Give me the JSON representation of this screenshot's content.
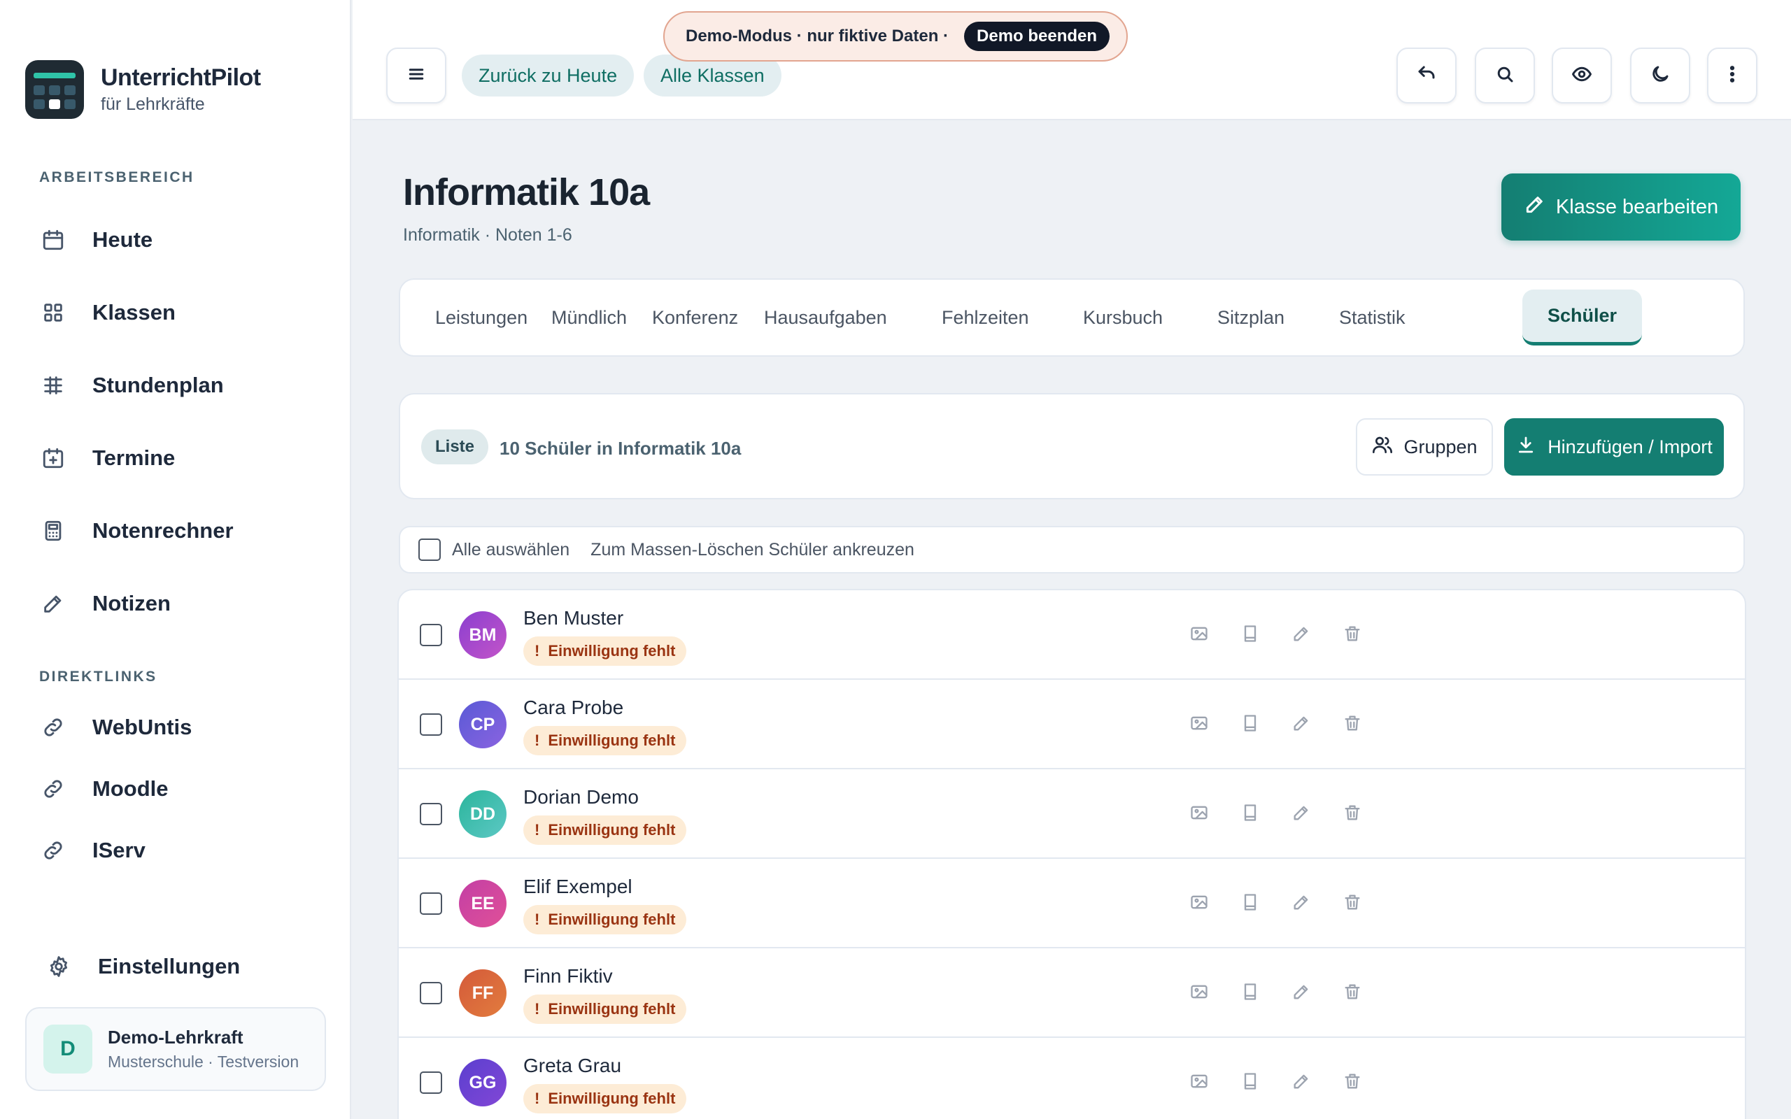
{
  "brand": {
    "name": "UnterrichtPilot",
    "subtitle": "für Lehrkräfte"
  },
  "sidebar": {
    "workspace_label": "ARBEITSBEREICH",
    "items": [
      {
        "label": "Heute",
        "icon": "calendar-icon"
      },
      {
        "label": "Klassen",
        "icon": "grid-icon"
      },
      {
        "label": "Stundenplan",
        "icon": "timetable-icon"
      },
      {
        "label": "Termine",
        "icon": "calendar-plus-icon"
      },
      {
        "label": "Notenrechner",
        "icon": "calculator-icon"
      },
      {
        "label": "Notizen",
        "icon": "pencil-icon"
      }
    ],
    "links_label": "DIREKTLINKS",
    "links": [
      {
        "label": "WebUntis",
        "icon": "link-icon"
      },
      {
        "label": "Moodle",
        "icon": "link-icon"
      },
      {
        "label": "IServ",
        "icon": "link-icon"
      }
    ],
    "settings_label": "Einstellungen",
    "user": {
      "initial": "D",
      "name": "Demo-Lehrkraft",
      "subtitle": "Musterschule · Testversion"
    }
  },
  "topbar": {
    "back_label": "Zurück zu Heute",
    "all_classes_label": "Alle Klassen",
    "demo_text": "Demo-Modus · nur fiktive Daten ·",
    "demo_end_label": "Demo beenden",
    "icons": [
      "menu-icon",
      "undo-icon",
      "search-icon",
      "eye-icon",
      "moon-icon",
      "more-vertical-icon"
    ]
  },
  "page": {
    "title": "Informatik 10a",
    "subject": "Informatik",
    "separator": "·",
    "grading": "Noten 1-6",
    "edit_label": "Klasse bearbeiten"
  },
  "tabs": [
    {
      "label": "Leistungen",
      "active": false
    },
    {
      "label": "Mündlich",
      "active": false
    },
    {
      "label": "Konferenz",
      "active": false
    },
    {
      "label": "Hausaufgaben",
      "active": false
    },
    {
      "label": "Fehlzeiten",
      "active": false
    },
    {
      "label": "Kursbuch",
      "active": false
    },
    {
      "label": "Sitzplan",
      "active": false
    },
    {
      "label": "Statistik",
      "active": false
    },
    {
      "label": "Schüler",
      "active": true
    }
  ],
  "list_header": {
    "view_badge": "Liste",
    "count_text": "10 Schüler in Informatik 10a",
    "groups_label": "Gruppen",
    "import_label": "Hinzufügen / Import"
  },
  "selection": {
    "select_all_label": "Alle auswählen",
    "hint": "Zum Massen-Löschen Schüler ankreuzen"
  },
  "students": [
    {
      "initials": "BM",
      "name": "Ben Muster",
      "warning": "Einwilligung fehlt",
      "color_from": "#8b3fd0",
      "color_to": "#c354c8"
    },
    {
      "initials": "CP",
      "name": "Cara Probe",
      "warning": "Einwilligung fehlt",
      "color_from": "#5a5ad6",
      "color_to": "#8a63e0"
    },
    {
      "initials": "DD",
      "name": "Dorian Demo",
      "warning": "Einwilligung fehlt",
      "color_from": "#2bb59c",
      "color_to": "#5cc8c4"
    },
    {
      "initials": "EE",
      "name": "Elif Exempel",
      "warning": "Einwilligung fehlt",
      "color_from": "#c33fa5",
      "color_to": "#e05098"
    },
    {
      "initials": "FF",
      "name": "Finn Fiktiv",
      "warning": "Einwilligung fehlt",
      "color_from": "#d45a3a",
      "color_to": "#e27c3e"
    },
    {
      "initials": "GG",
      "name": "Greta Grau",
      "warning": "Einwilligung fehlt",
      "color_from": "#5b3fcf",
      "color_to": "#8247d6"
    }
  ],
  "warning_mark": "!",
  "colors": {
    "accent": "#147e72",
    "accent_light": "#e3eef1",
    "warning_bg": "#fdecd6",
    "warning_text": "#9a3412"
  }
}
